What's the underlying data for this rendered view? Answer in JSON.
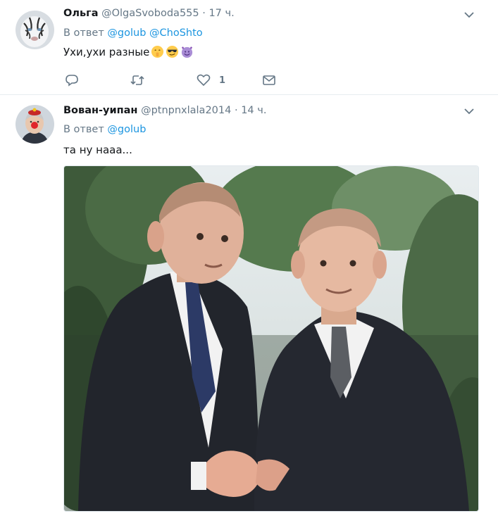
{
  "tweets": [
    {
      "name": "Ольга",
      "handle": "@OlgaSvoboda555",
      "dot": "·",
      "time": "17 ч.",
      "reply_prefix": "В ответ",
      "mentions": [
        "@golub",
        "@ChoShto"
      ],
      "text": "Ухи,ухи разные",
      "emojis": [
        "shushing-face-emoji",
        "sunglasses-face-emoji",
        "smiling-devil-emoji"
      ],
      "actions": {
        "reply_count": "",
        "retweet_count": "",
        "like_count": "1"
      }
    },
    {
      "name": "Вован-уипан",
      "handle": "@ptnpnxlala2014",
      "dot": "·",
      "time": "14 ч.",
      "reply_prefix": "В ответ",
      "mentions": [
        "@golub"
      ],
      "text": "та ну нааа...",
      "media": "photo-two-men-in-suits-shaking-hands"
    }
  ],
  "colors": {
    "link": "#1b95e0",
    "secondary_text": "#657786",
    "divider": "#e6ecf0"
  },
  "icons": [
    "reply-icon",
    "retweet-icon",
    "like-icon",
    "direct-message-icon",
    "chevron-down-icon"
  ]
}
